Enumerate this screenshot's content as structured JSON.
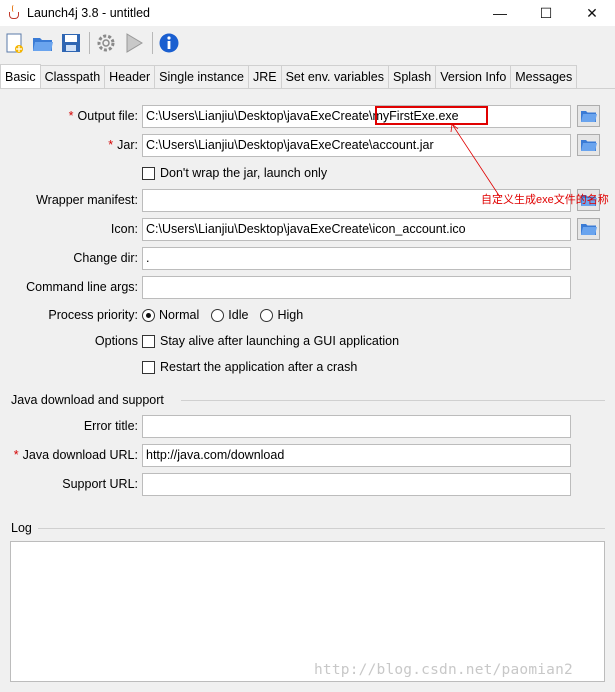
{
  "window": {
    "title": "Launch4j 3.8 - untitled",
    "minimize": "—",
    "maximize": "☐",
    "close": "✕"
  },
  "toolbar": {
    "icons": [
      "new-file-icon",
      "open-folder-icon",
      "save-icon",
      "build-gear-icon",
      "run-play-icon",
      "info-icon"
    ]
  },
  "tabs": [
    "Basic",
    "Classpath",
    "Header",
    "Single instance",
    "JRE",
    "Set env. variables",
    "Splash",
    "Version Info",
    "Messages"
  ],
  "basic": {
    "output_file_label": "Output file:",
    "output_file_value": "C:\\Users\\Lianjiu\\Desktop\\javaExeCreate\\myFirstExe.exe",
    "jar_label": "Jar:",
    "jar_value": "C:\\Users\\Lianjiu\\Desktop\\javaExeCreate\\account.jar",
    "dont_wrap_label": "Don't wrap the jar, launch only",
    "wrapper_manifest_label": "Wrapper manifest:",
    "wrapper_manifest_value": "",
    "icon_label": "Icon:",
    "icon_value": "C:\\Users\\Lianjiu\\Desktop\\javaExeCreate\\icon_account.ico",
    "change_dir_label": "Change dir:",
    "change_dir_value": ".",
    "cmd_args_label": "Command line args:",
    "cmd_args_value": "",
    "priority_label": "Process priority:",
    "priority_options": [
      "Normal",
      "Idle",
      "High"
    ],
    "options_label": "Options",
    "stay_alive_label": "Stay alive after launching a GUI application",
    "restart_label": "Restart the application after a crash",
    "required_mark": "*"
  },
  "java_download": {
    "title": "Java download and support",
    "error_title_label": "Error title:",
    "error_title_value": "",
    "download_url_label": "Java download URL:",
    "download_url_value": "http://java.com/download",
    "support_url_label": "Support URL:",
    "support_url_value": ""
  },
  "log": {
    "title": "Log"
  },
  "annotation": {
    "text": "自定义生成exe文件的名称"
  },
  "watermark": "http://blog.csdn.net/paomian2",
  "colors": {
    "annotation": "#e00000",
    "required": "#d40000",
    "info": "#1a5fd0"
  }
}
